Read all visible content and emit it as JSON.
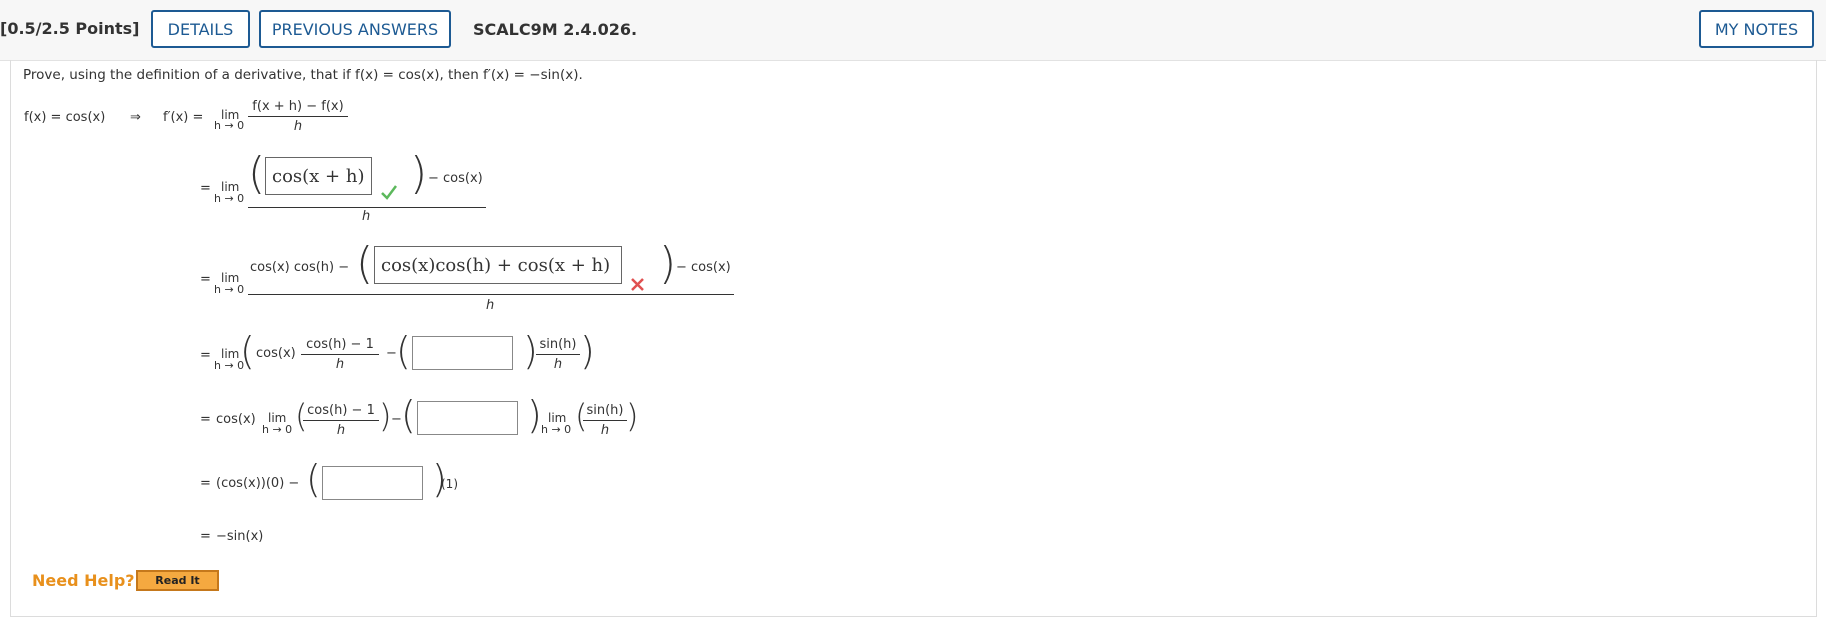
{
  "header": {
    "points": "[0.5/2.5 Points]",
    "details_label": "DETAILS",
    "previous_answers_label": "PREVIOUS ANSWERS",
    "question_id": "SCALC9M 2.4.026.",
    "my_notes_label": "MY NOTES"
  },
  "prompt": "Prove, using the definition of a derivative, that if f(x) = cos(x), then f′(x) = −sin(x).",
  "math": {
    "line1_lhs": "f(x) = cos(x)",
    "arrow": "⇒",
    "fprime": "f′(x) =",
    "eq": "=",
    "lim": "lim",
    "lim_sub": "h → 0",
    "line1_num": "f(x + h) − f(x)",
    "h": "h",
    "minus_cos": "− cos(x)",
    "minus": "−",
    "line3_num_prefix": "cos(x) cos(h) −",
    "cos_x": "cos(x)",
    "cosh_minus_1": "cos(h) − 1",
    "sin_h": "sin(h)",
    "line6_prefix": "(cos(x))(0) −",
    "one": "(1)",
    "final": "−sin(x)"
  },
  "answers": {
    "blank1": {
      "value": "cos(x + h)",
      "status": "correct"
    },
    "blank2": {
      "value": "cos(x)cos(h) + cos(x + h)",
      "status": "incorrect"
    },
    "blank3": {
      "value": ""
    },
    "blank4": {
      "value": ""
    },
    "blank5": {
      "value": ""
    }
  },
  "help": {
    "need_help": "Need Help?",
    "read_it": "Read It"
  },
  "colors": {
    "accent": "#1d5a93",
    "correct": "#5cb85c",
    "incorrect": "#e05050",
    "help": "#e8901c"
  }
}
